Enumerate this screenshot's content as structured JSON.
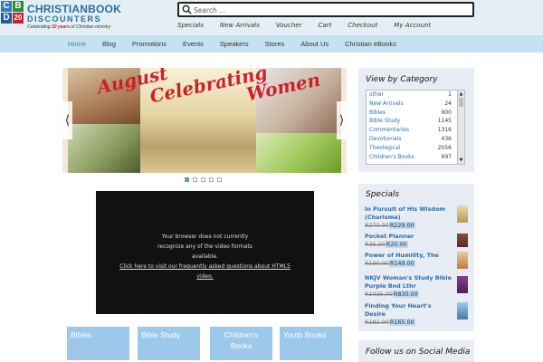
{
  "logo": {
    "letters": [
      "C",
      "B",
      "D",
      "20"
    ],
    "letter_colors": [
      "#2c7fb8",
      "#2d8f3c",
      "#1f5e9a",
      "#c1272d"
    ],
    "line1": "CHRISTIANBOOK",
    "line2": "DISCOUNTERS",
    "tagline_pre": "Celebrating ",
    "tagline_highlight": "20 years",
    "tagline_post": " of Christian ministry"
  },
  "search": {
    "placeholder": "Search ...",
    "icon": "search-icon"
  },
  "top_links": [
    "Specials",
    "New Arrivals",
    "Voucher",
    "Cart",
    "Checkout",
    "My Account"
  ],
  "main_nav": {
    "items": [
      "Home",
      "Blog",
      "Promotions",
      "Events",
      "Speakers",
      "Stores",
      "About Us",
      "Christian eBooks"
    ],
    "active": "Home"
  },
  "slider": {
    "headline_1": "August",
    "headline_2": "Celebrating",
    "headline_3": "Women",
    "prev": "⟨",
    "next": "⟩",
    "dots_total": 5,
    "dot_active_index": 0
  },
  "video": {
    "message": "Your browser does not currently recognize any of the video formats available.",
    "link": "Click here to visit our frequently asked questions about HTML5 video."
  },
  "category_tiles": [
    "Bibles",
    "Bible Study",
    "Children's Books",
    "Youth Books"
  ],
  "view_by_category": {
    "title": "View by Category",
    "items": [
      {
        "name": "other",
        "count": "1"
      },
      {
        "name": "New Arrivals",
        "count": "24"
      },
      {
        "name": "Bibles",
        "count": "900"
      },
      {
        "name": "Bible Study",
        "count": "1145"
      },
      {
        "name": "Commentaries",
        "count": "1316"
      },
      {
        "name": "Devotionals",
        "count": "436"
      },
      {
        "name": "Theological",
        "count": "2056"
      },
      {
        "name": "Children's Books",
        "count": "697"
      }
    ]
  },
  "specials": {
    "title": "Specials",
    "items": [
      {
        "title": "In Pursuit of His Wisdom (Charisma)",
        "old_price": "R270.00",
        "new_price": "R229.00"
      },
      {
        "title": "Pocket Planner",
        "old_price": "R35.00",
        "new_price": "R20.00"
      },
      {
        "title": "Power of Humility, The",
        "old_price": "R190.00",
        "new_price": "R149.00"
      },
      {
        "title": "NKJV Woman's Study Bible Purple Bnd Lthr",
        "old_price": "R1035.00",
        "new_price": "R830.00"
      },
      {
        "title": "Finding Your Heart's Desire",
        "old_price": "R182.00",
        "new_price": "R165.00"
      }
    ]
  },
  "social": {
    "title": "Follow us on Social Media"
  },
  "colors": {
    "topbar": "#e3eff4",
    "nav": "#c6e1ef",
    "accent_link": "#2c6da6",
    "tile": "#9cc8ea",
    "headline": "#d01f2c",
    "sidebar_box": "#e8ecf4"
  }
}
